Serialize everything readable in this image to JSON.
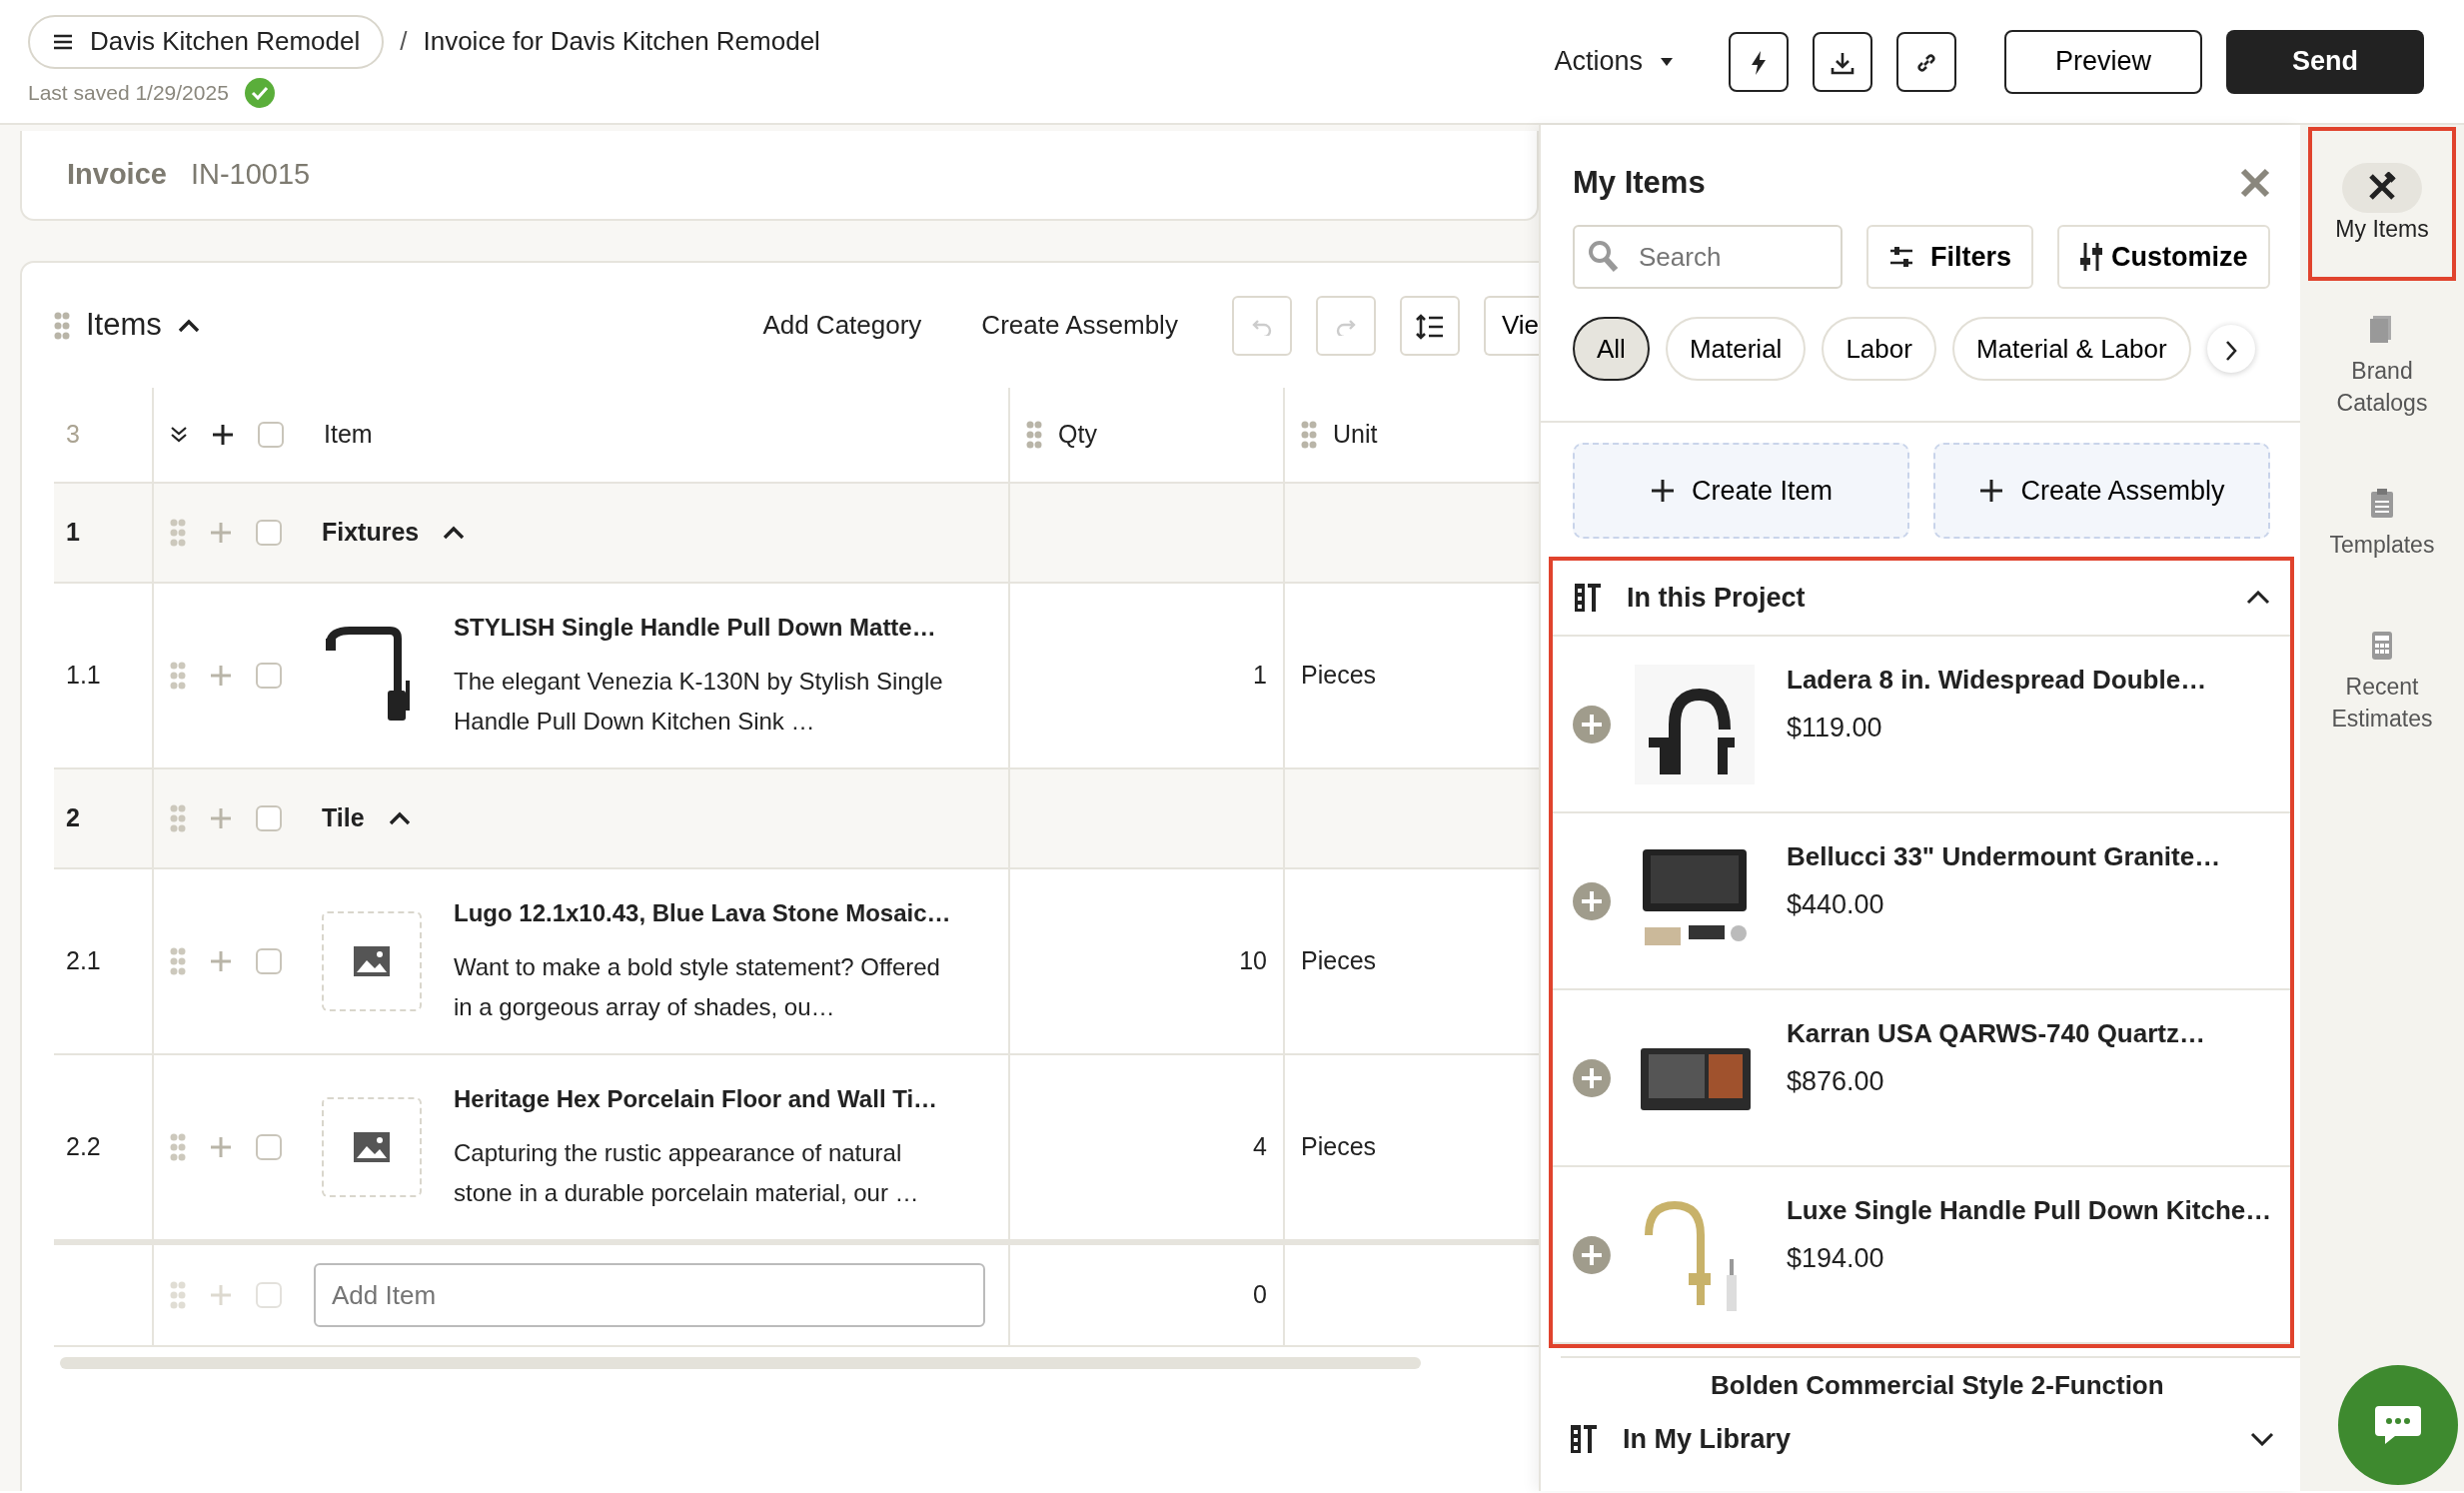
{
  "header": {
    "project": "Davis Kitchen Remodel",
    "separator": "/",
    "title": "Invoice for Davis Kitchen Remodel",
    "last_saved": "Last saved 1/29/2025",
    "saved": true,
    "actions": "Actions",
    "preview": "Preview",
    "send": "Send"
  },
  "invoice": {
    "label": "Invoice",
    "number": "IN-10015"
  },
  "items_section": {
    "title": "Items",
    "expanded": true,
    "toolbar": [
      "Add Category",
      "Create Assembly"
    ],
    "view_button": "Vie"
  },
  "table": {
    "count": "3",
    "columns": [
      "Item",
      "Qty",
      "Unit"
    ],
    "header_checked": false,
    "rows": [
      {
        "kind": "category",
        "number": "1",
        "name": "Fixtures",
        "expanded": true,
        "checked": false
      },
      {
        "kind": "item",
        "number": "1.1",
        "title": "STYLISH Single Handle Pull Down Matte…",
        "description": "The elegant Venezia K-130N by Stylish Single Handle Pull Down Kitchen Sink …",
        "qty": "1",
        "unit": "Pieces",
        "checked": false
      },
      {
        "kind": "category",
        "number": "2",
        "name": "Tile",
        "expanded": true,
        "checked": false
      },
      {
        "kind": "item",
        "number": "2.1",
        "title": "Lugo 12.1x10.43, Blue Lava Stone Mosaic…",
        "description": "Want to make a bold style statement? Offered in a gorgeous array of shades, ou…",
        "qty": "10",
        "unit": "Pieces",
        "checked": false
      },
      {
        "kind": "item",
        "number": "2.2",
        "title": "Heritage Hex Porcelain Floor and Wall Ti…",
        "description": "Capturing the rustic appearance of natural stone in a durable porcelain material, our …",
        "qty": "4",
        "unit": "Pieces",
        "checked": false
      }
    ],
    "add_item": {
      "placeholder": "Add Item",
      "qty": "0",
      "checked": false
    }
  },
  "panel": {
    "title": "My Items",
    "search": {
      "placeholder": "Search"
    },
    "filters": "Filters",
    "customize": "Customize",
    "chips": [
      {
        "label": "All",
        "selected": true
      },
      {
        "label": "Material",
        "selected": false
      },
      {
        "label": "Labor",
        "selected": false
      },
      {
        "label": "Material & Labor",
        "selected": false
      }
    ],
    "create_buttons": [
      "Create Item",
      "Create Assembly"
    ],
    "sections": [
      {
        "title": "In this Project",
        "expanded": true,
        "highlighted": true,
        "products": [
          {
            "name": "Ladera 8 in. Widespread Double…",
            "price": "$119.00"
          },
          {
            "name": "Bellucci 33\" Undermount Granite…",
            "price": "$440.00"
          },
          {
            "name": "Karran USA QARWS-740 Quartz…",
            "price": "$876.00"
          },
          {
            "name": "Luxe Single Handle Pull Down Kitche…",
            "price": "$194.00"
          }
        ],
        "partial_product": "Bolden Commercial Style 2-Function"
      },
      {
        "title": "In My Library",
        "expanded": false,
        "highlighted": false
      }
    ]
  },
  "sidebar": {
    "items": [
      {
        "label": "My Items",
        "selected": true,
        "highlighted": true
      },
      {
        "label": "Brand Catalogs",
        "selected": false,
        "highlighted": false
      },
      {
        "label": "Templates",
        "selected": false,
        "highlighted": false
      },
      {
        "label": "Recent Estimates",
        "selected": false,
        "highlighted": false
      }
    ]
  }
}
